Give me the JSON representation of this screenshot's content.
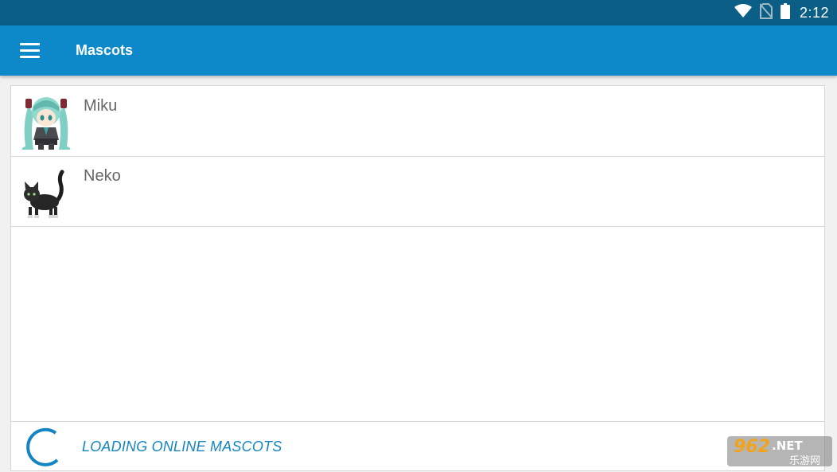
{
  "status_bar": {
    "time": "2:12",
    "icons": [
      "wifi-icon",
      "no-sim-icon",
      "battery-icon"
    ],
    "background": "#0b5f86"
  },
  "app_bar": {
    "title": "Mascots",
    "menu_icon": "hamburger-menu-icon",
    "background": "#0d88c8"
  },
  "mascots": {
    "items": [
      {
        "name": "Miku",
        "icon": "miku-avatar-icon"
      },
      {
        "name": "Neko",
        "icon": "cat-avatar-icon"
      }
    ]
  },
  "loading": {
    "text": "LOADING ONLINE MASCOTS",
    "icon": "loading-spinner-icon",
    "color": "#1485c2"
  },
  "watermark": {
    "logo": "962",
    "suffix": ".NET",
    "subtitle": "乐游网"
  }
}
